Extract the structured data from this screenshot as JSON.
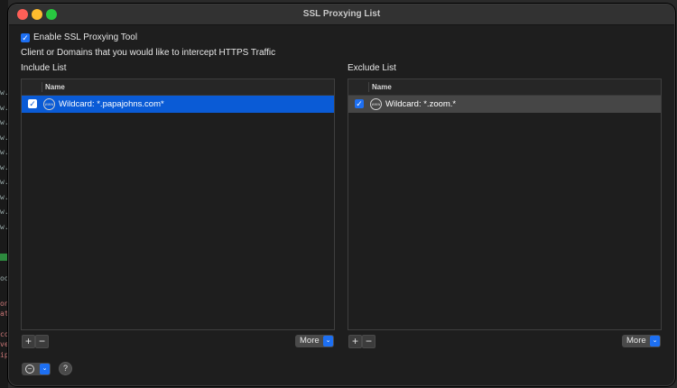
{
  "window": {
    "title": "SSL Proxying List"
  },
  "enable_checkbox": {
    "label": "Enable SSL Proxying Tool",
    "checked": true
  },
  "description": "Client or Domains that you would like to intercept HTTPS Traffic",
  "include_list": {
    "heading": "Include List",
    "column": "Name",
    "rows": [
      {
        "label": "Wildcard: *.papajohns.com*",
        "checked": true,
        "selected": true
      }
    ]
  },
  "exclude_list": {
    "heading": "Exclude List",
    "column": "Name",
    "rows": [
      {
        "label": "Wildcard: *.zoom.*",
        "checked": true,
        "selected": true
      }
    ]
  },
  "buttons": {
    "add": "+",
    "remove": "−",
    "more": "More",
    "help": "?"
  },
  "background_app": {
    "lines": [
      "w.l",
      "w.l",
      "w.l",
      "w.l",
      "w.l",
      "w.l",
      "w.l",
      "w.l",
      "w.l",
      "w.l",
      "od",
      "on",
      "ati",
      "co",
      "ve",
      "ip"
    ]
  }
}
